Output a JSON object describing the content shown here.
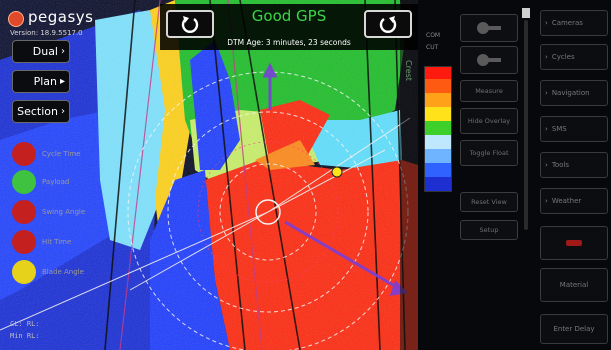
{
  "brand": {
    "name": "pegasys",
    "version": "Version: 18.9.5517.0"
  },
  "nav_buttons": [
    {
      "label": "Dual",
      "arrow": "›"
    },
    {
      "label": "Plan",
      "arrow": "▸"
    },
    {
      "label": "Section",
      "arrow": "›"
    }
  ],
  "top_bar": {
    "gps_status": "Good GPS",
    "gps_detail": "",
    "dtm_age": "DTM Age: 3 minutes, 23 seconds"
  },
  "status_lights": [
    {
      "label": "Cycle Time",
      "value": "",
      "color": "#c42020"
    },
    {
      "label": "Payload",
      "value": "",
      "color": "#3fc23f"
    },
    {
      "label": "Swing Angle",
      "value": "",
      "color": "#c42020"
    },
    {
      "label": "Hit Time",
      "value": "",
      "color": "#c42020"
    },
    {
      "label": "Blade Angle",
      "value": "",
      "color": "#e6d21a"
    }
  ],
  "readouts": {
    "line1": "CL: RL:",
    "line2": "Min RL:"
  },
  "map_labels": {
    "design": "Crest"
  },
  "right_tools": [
    {
      "label": "Measure"
    },
    {
      "label": "Hide Overlay"
    },
    {
      "label": "Toggle Float"
    },
    {
      "label": "Reset View"
    },
    {
      "label": "Setup"
    }
  ],
  "right_menu": [
    {
      "label": "Cameras"
    },
    {
      "label": "Cycles"
    },
    {
      "label": "Navigation"
    },
    {
      "label": "SMS"
    },
    {
      "label": "Tools"
    },
    {
      "label": "Weather"
    },
    {
      "label": ""
    },
    {
      "label": "Material"
    },
    {
      "label": "Enter Delay"
    }
  ],
  "color_scale": {
    "top": "COM",
    "bottom": "CUT"
  },
  "colors": {
    "cut_red": "#ff2a10",
    "fill_green": "#1fbf2a",
    "deep_blue": "#1c3cff",
    "gps_green": "#3bd64a"
  }
}
